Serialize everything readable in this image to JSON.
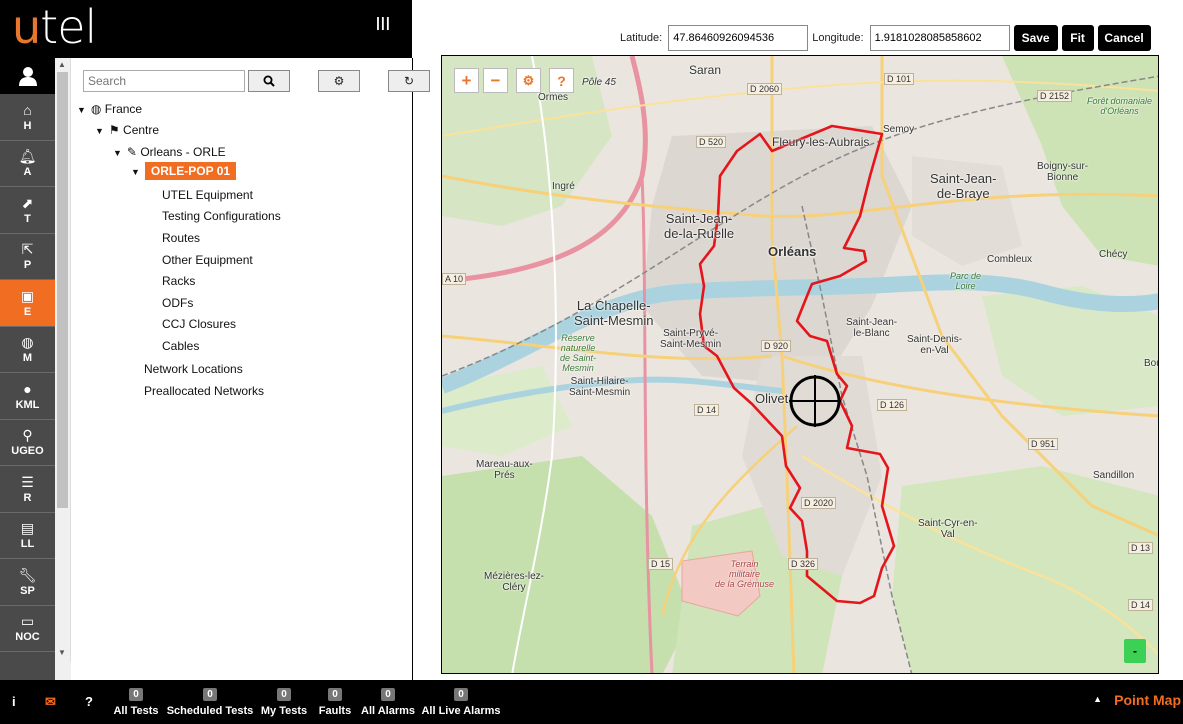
{
  "brand": {
    "logo_u": "u",
    "logo_rest": "tel",
    "menu_icon": "bars-icon"
  },
  "nav": {
    "user_icon": "user-icon",
    "items": [
      {
        "label": "H",
        "icon": "home-icon"
      },
      {
        "label": "A",
        "icon": "bell-icon"
      },
      {
        "label": "T",
        "icon": "chart-icon"
      },
      {
        "label": "P",
        "icon": "share-icon"
      },
      {
        "label": "E",
        "icon": "chip-icon",
        "active": true
      },
      {
        "label": "M",
        "icon": "globe-icon"
      },
      {
        "label": "KML",
        "icon": "map-pin-icon"
      },
      {
        "label": "UGEO",
        "icon": "map-pin-icon"
      },
      {
        "label": "R",
        "icon": "server-icon"
      },
      {
        "label": "LL",
        "icon": "book-icon"
      },
      {
        "label": "SP",
        "icon": "wrench-icon"
      },
      {
        "label": "NOC",
        "icon": "laptop-icon"
      }
    ]
  },
  "tree": {
    "search_placeholder": "Search",
    "nodes": {
      "france": "France",
      "centre": "Centre",
      "orleans": "Orleans - ORLE",
      "pop": "ORLE-POP 01",
      "utel_equipment": "UTEL Equipment",
      "testing_configurations": "Testing Configurations",
      "routes": "Routes",
      "other_equipment": "Other Equipment",
      "racks": "Racks",
      "odfs": "ODFs",
      "ccj_closures": "CCJ Closures",
      "cables": "Cables",
      "network_locations": "Network Locations",
      "preallocated_networks": "Preallocated Networks"
    }
  },
  "coords": {
    "latitude_label": "Latitude:",
    "latitude_value": "47.86460926094536",
    "longitude_label": "Longitude:",
    "longitude_value": "1.9181028085858602",
    "save": "Save",
    "fit": "Fit",
    "cancel": "Cancel"
  },
  "map": {
    "controls": {
      "zoom_in": "+",
      "zoom_out": "−",
      "settings": "⚙",
      "help": "?"
    },
    "green_button": "-",
    "labels": {
      "saran": "Saran",
      "ormes": "Ormes",
      "pole45": "Pôle 45",
      "fleury": "Fleury-les-Aubrais",
      "semoy": "Semoy",
      "foret1": "Forêt domaniale",
      "foret2": "d'Orléans",
      "boigny1": "Boigny-sur-",
      "boigny2": "Bionne",
      "ingre": "Ingré",
      "sjb1": "Saint-Jean-",
      "sjb2": "de-Braye",
      "sjr1": "Saint-Jean-",
      "sjr2": "de-la-Ruelle",
      "orleans": "Orléans",
      "combleux": "Combleux",
      "checy": "Chécy",
      "parc1": "Parc de",
      "parc2": "Loire",
      "chapelle1": "La Chapelle-",
      "chapelle2": "Saint-Mesmin",
      "priv1": "Saint-Pryvé-",
      "priv2": "Saint-Mesmin",
      "sjlb1": "Saint-Jean-",
      "sjlb2": "le-Blanc",
      "sdv1": "Saint-Denis-",
      "sdv2": "en-Val",
      "reserve1": "Réserve",
      "reserve2": "naturelle",
      "reserve3": "de Saint-",
      "reserve4": "Mesmin",
      "sh1": "Saint-Hilaire-",
      "sh2": "Saint-Mesmin",
      "olivet": "Olivet",
      "bou": "Bou",
      "mareau1": "Mareau-aux-",
      "mareau2": "Prés",
      "sandillon": "Sandillon",
      "scv1": "Saint-Cyr-en-",
      "scv2": "Val",
      "terrain1": "Terrain",
      "terrain2": "militaire",
      "terrain3": "de la Grémuse",
      "mez1": "Mézières-lez-",
      "mez2": "Cléry"
    },
    "roads": {
      "d2060": "D 2060",
      "d101": "D 101",
      "d2152": "D 2152",
      "d520": "D 520",
      "a10": "A 10",
      "d920": "D 920",
      "d14a": "D 14",
      "d126": "D 126",
      "d951": "D 951",
      "d2020": "D 2020",
      "d15": "D 15",
      "d326": "D 326",
      "d13": "D 13",
      "d14b": "D 14"
    }
  },
  "footer": {
    "info_icon": "info-icon",
    "mail_icon": "envelope-icon",
    "help_icon": "question-icon",
    "stats": [
      {
        "count": "0",
        "label": "All Tests"
      },
      {
        "count": "0",
        "label": "Scheduled Tests"
      },
      {
        "count": "0",
        "label": "My Tests"
      },
      {
        "count": "0",
        "label": "Faults"
      },
      {
        "count": "0",
        "label": "All Alarms"
      },
      {
        "count": "0",
        "label": "All Live Alarms"
      }
    ],
    "mode_label": "Point Map"
  }
}
